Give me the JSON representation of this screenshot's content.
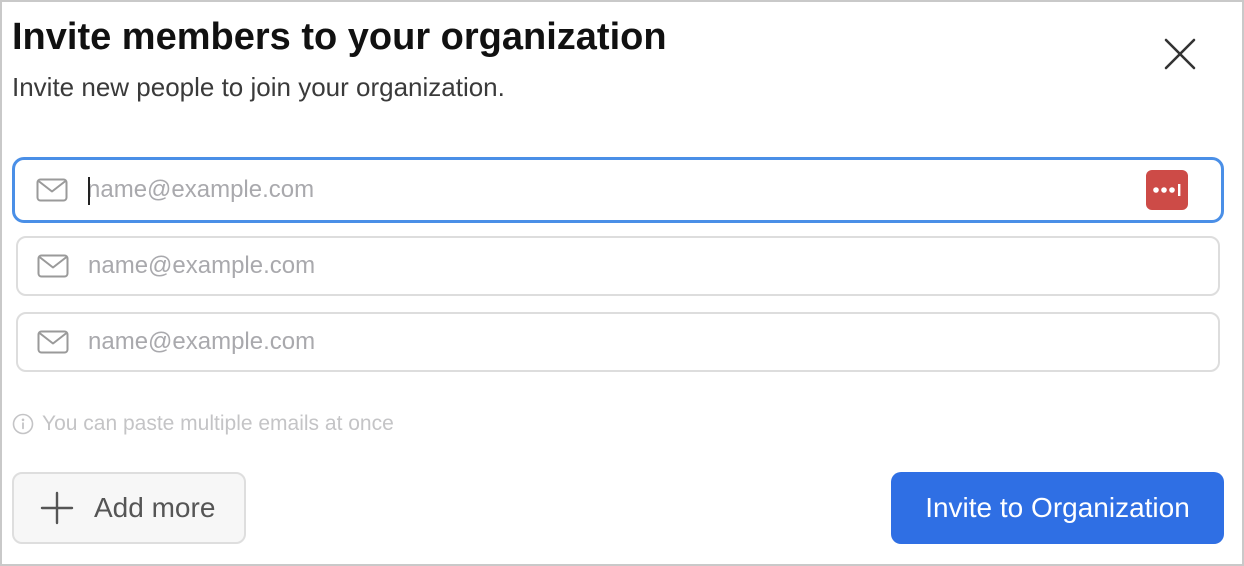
{
  "dialog": {
    "title": "Invite members to your organization",
    "subtitle": "Invite new people to join your organization."
  },
  "close_button": {
    "icon": "close-icon"
  },
  "email_fields": [
    {
      "placeholder": "name@example.com",
      "value": "",
      "icon": "mail-icon",
      "focused": true,
      "password_manager_icon": "password-manager-icon"
    },
    {
      "placeholder": "name@example.com",
      "value": "",
      "icon": "mail-icon",
      "focused": false
    },
    {
      "placeholder": "name@example.com",
      "value": "",
      "icon": "mail-icon",
      "focused": false
    }
  ],
  "hint": {
    "icon": "info-icon",
    "text": "You can paste multiple emails at once"
  },
  "actions": {
    "add_more_label": "Add more",
    "add_more_icon": "plus-icon",
    "invite_label": "Invite to Organization"
  },
  "colors": {
    "primary": "#2f6fe4",
    "focus_ring": "#4a8fe7",
    "password_manager": "#cd4b47",
    "placeholder": "#a9a9ad"
  }
}
